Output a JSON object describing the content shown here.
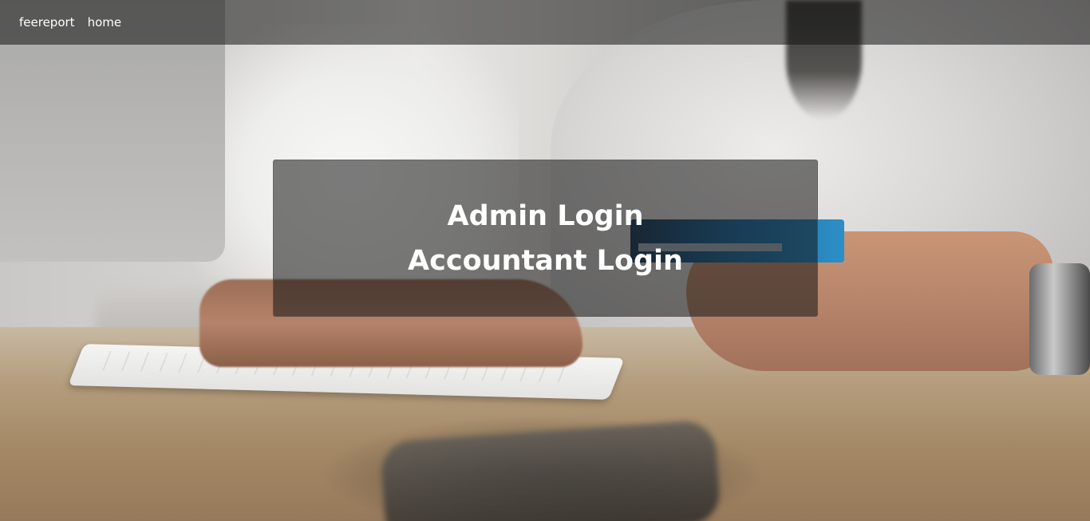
{
  "navbar": {
    "brand": "feereport",
    "links": [
      {
        "label": "home"
      }
    ]
  },
  "login_panel": {
    "links": [
      {
        "label": "Admin Login"
      },
      {
        "label": "Accountant Login"
      }
    ]
  }
}
